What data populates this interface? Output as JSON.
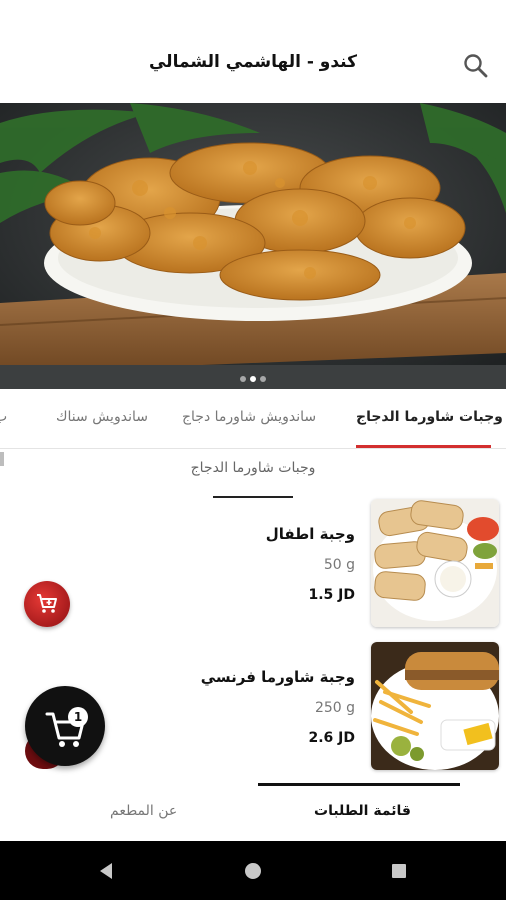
{
  "app": {
    "title": "كندو - الهاشمي الشمالي"
  },
  "icons": {
    "search": "search-icon",
    "add_to_cart": "add-cart-icon",
    "cart": "shopping-cart-icon",
    "back": "nav-back-icon",
    "home": "nav-home-icon",
    "recents": "nav-recents-icon"
  },
  "hero": {
    "slide_count": 3,
    "active_slide": 2
  },
  "categories": {
    "tabs": [
      {
        "label": "وجبات شاورما الدجاج",
        "active": true
      },
      {
        "label": "ساندويش شاورما دجاج",
        "active": false
      },
      {
        "label": "ساندويش سناك",
        "active": false
      },
      {
        "label": "ب",
        "active": false
      }
    ]
  },
  "section": {
    "title": "وجبات شاورما الدجاج"
  },
  "menu_items": [
    {
      "name": "وجبة اطفال",
      "weight": "50 g",
      "price": "1.5 JD"
    },
    {
      "name": "وجبة شاورما فرنسي",
      "weight": "250 g",
      "price": "2.6 JD"
    }
  ],
  "cart": {
    "count": "1"
  },
  "bottom_tabs": {
    "orders_label": "قائمة الطلبات",
    "about_label": "عن المطعم"
  },
  "colors": {
    "accent": "#d32f2f",
    "fab_red": "#b71c1c",
    "text_primary": "#111111",
    "text_secondary": "#777777"
  }
}
